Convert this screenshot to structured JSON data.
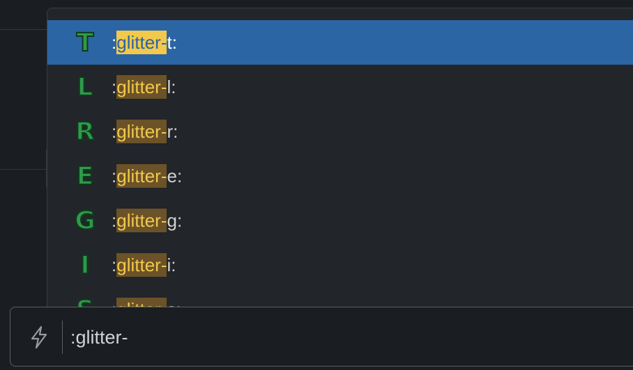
{
  "autocomplete": {
    "items": [
      {
        "glyph": "T",
        "prefix": ":",
        "match": "glitter-",
        "suffix": "t:",
        "selected": true
      },
      {
        "glyph": "L",
        "prefix": ":",
        "match": "glitter-",
        "suffix": "l:",
        "selected": false
      },
      {
        "glyph": "R",
        "prefix": ":",
        "match": "glitter-",
        "suffix": "r:",
        "selected": false
      },
      {
        "glyph": "E",
        "prefix": ":",
        "match": "glitter-",
        "suffix": "e:",
        "selected": false
      },
      {
        "glyph": "G",
        "prefix": ":",
        "match": "glitter-",
        "suffix": "g:",
        "selected": false
      },
      {
        "glyph": "I",
        "prefix": ":",
        "match": "glitter-",
        "suffix": "i:",
        "selected": false
      },
      {
        "glyph": "S",
        "prefix": ":",
        "match": "glitter-",
        "suffix": "s:",
        "selected": false
      }
    ]
  },
  "composer": {
    "value": ":glitter-",
    "icon": "lightning-bolt-icon"
  },
  "colors": {
    "selected_bg": "#2c65a3",
    "match_highlight_bg": "#6b5228",
    "match_highlight_text": "#f2c94c",
    "glitter_green": "#2f9a4c"
  }
}
